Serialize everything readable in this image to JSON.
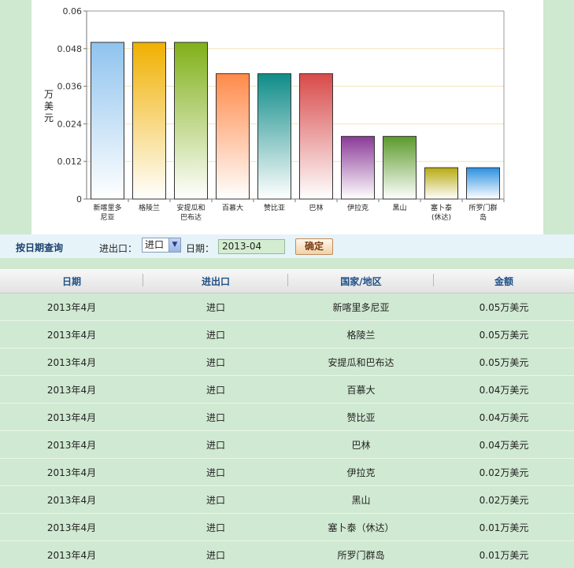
{
  "chart_data": {
    "type": "bar",
    "ylabel": "万美元",
    "ylim": [
      0,
      0.06
    ],
    "yticks": [
      "0",
      "0.012",
      "0.024",
      "0.036",
      "0.048",
      "0.06"
    ],
    "categories": [
      "新喀里多尼亚",
      "格陵兰",
      "安提瓜和巴布达",
      "百慕大",
      "赞比亚",
      "巴林",
      "伊拉克",
      "黑山",
      "塞卜泰（休达）",
      "所罗门群岛"
    ],
    "category_lines": [
      [
        "新喀里多",
        "尼亚"
      ],
      [
        "格陵兰"
      ],
      [
        "安提瓜和",
        "巴布达"
      ],
      [
        "百慕大"
      ],
      [
        "赞比亚"
      ],
      [
        "巴林"
      ],
      [
        "伊拉克"
      ],
      [
        "黑山"
      ],
      [
        "塞卜泰",
        "(休达)"
      ],
      [
        "所罗门群",
        "岛"
      ]
    ],
    "values": [
      0.05,
      0.05,
      0.05,
      0.04,
      0.04,
      0.04,
      0.02,
      0.02,
      0.01,
      0.01
    ],
    "colors": [
      "#8fc3ee",
      "#f0b000",
      "#80b018",
      "#ff8a4a",
      "#0e8c88",
      "#d84a4a",
      "#8a3a98",
      "#5a9a2a",
      "#b8aa10",
      "#2a90e0"
    ],
    "grid": true,
    "grid_color": "#f3e2b4"
  },
  "query": {
    "title": "按日期查询",
    "io_label": "进出口：",
    "io_value": "进口",
    "date_label": "日期：",
    "date_value": "2013-04",
    "confirm_label": "确定"
  },
  "table": {
    "headers": [
      "日期",
      "进出口",
      "国家/地区",
      "金额"
    ],
    "rows": [
      [
        "2013年4月",
        "进口",
        "新喀里多尼亚",
        "0.05万美元"
      ],
      [
        "2013年4月",
        "进口",
        "格陵兰",
        "0.05万美元"
      ],
      [
        "2013年4月",
        "进口",
        "安提瓜和巴布达",
        "0.05万美元"
      ],
      [
        "2013年4月",
        "进口",
        "百慕大",
        "0.04万美元"
      ],
      [
        "2013年4月",
        "进口",
        "赞比亚",
        "0.04万美元"
      ],
      [
        "2013年4月",
        "进口",
        "巴林",
        "0.04万美元"
      ],
      [
        "2013年4月",
        "进口",
        "伊拉克",
        "0.02万美元"
      ],
      [
        "2013年4月",
        "进口",
        "黑山",
        "0.02万美元"
      ],
      [
        "2013年4月",
        "进口",
        "塞卜泰（休达）",
        "0.01万美元"
      ],
      [
        "2013年4月",
        "进口",
        "所罗门群岛",
        "0.01万美元"
      ]
    ]
  }
}
